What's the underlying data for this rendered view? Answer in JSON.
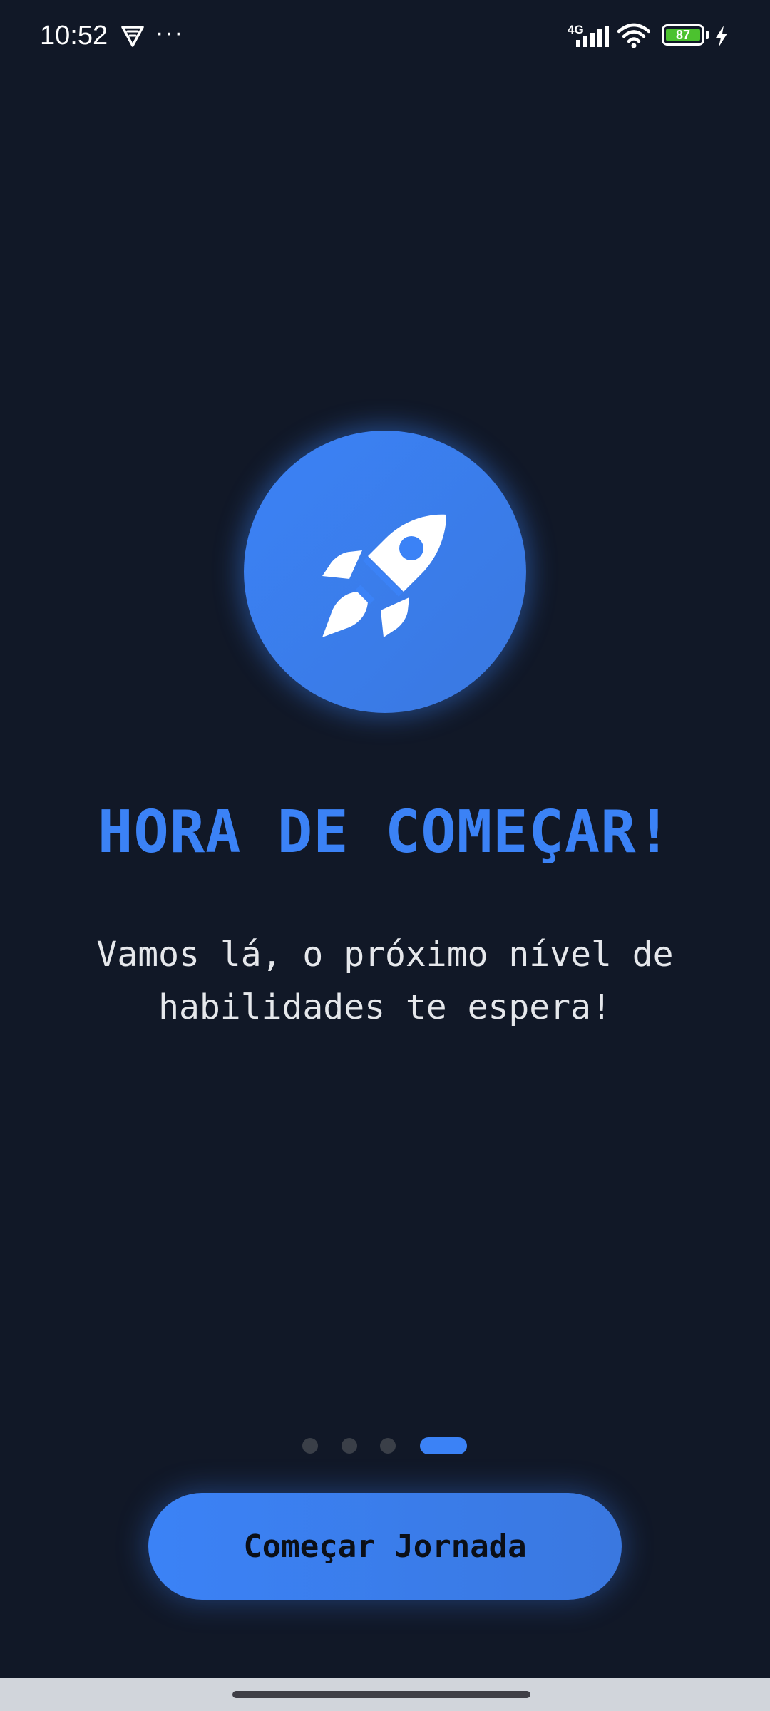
{
  "status_bar": {
    "time": "10:52",
    "more": "···",
    "network_type": "4G",
    "battery_level": "87",
    "icons": [
      "vpn-icon",
      "signal-icon",
      "wifi-icon",
      "battery-icon",
      "charging-icon"
    ]
  },
  "hero": {
    "icon": "rocket-icon",
    "accent_color": "#3b82f6"
  },
  "content": {
    "title": "HORA DE COMEÇAR!",
    "subtitle_line1": "Vamos lá, o próximo nível de",
    "subtitle_line2": "habilidades te espera!"
  },
  "pager": {
    "total": 4,
    "active_index": 3
  },
  "cta": {
    "label": "Começar Jornada"
  },
  "colors": {
    "background": "#111827",
    "accent": "#3b82f6",
    "text_light": "#e5e7eb",
    "inactive_dot": "#3a3f48"
  }
}
